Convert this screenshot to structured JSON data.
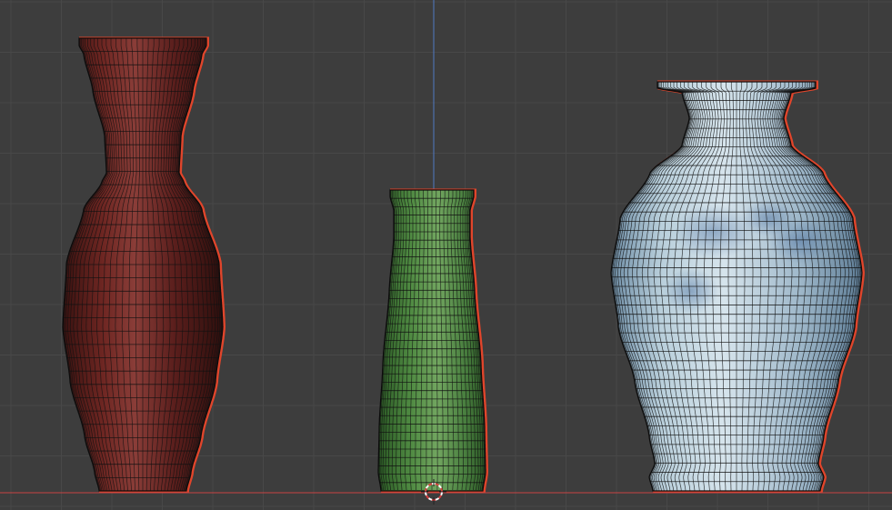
{
  "viewport": {
    "background": "#3d3d3d",
    "grid_color": "#484848",
    "x_axis_color": "#c94343",
    "z_axis_color": "#4f79c2",
    "wire_color": "#121212",
    "selection_outline_color": "#e0452b"
  },
  "objects": [
    {
      "name_icon": "red-vase-mesh",
      "color": "#5a1e1c",
      "highlight": "#8a3d38"
    },
    {
      "name_icon": "green-vase-mesh",
      "color": "#3f7a35",
      "highlight": "#72a660"
    },
    {
      "name_icon": "blue-white-vase-mesh",
      "color": "#a9c2d2",
      "highlight": "#dde9ef"
    }
  ],
  "cursor": {
    "icon": "3d-cursor-icon",
    "color": "#d94040"
  }
}
